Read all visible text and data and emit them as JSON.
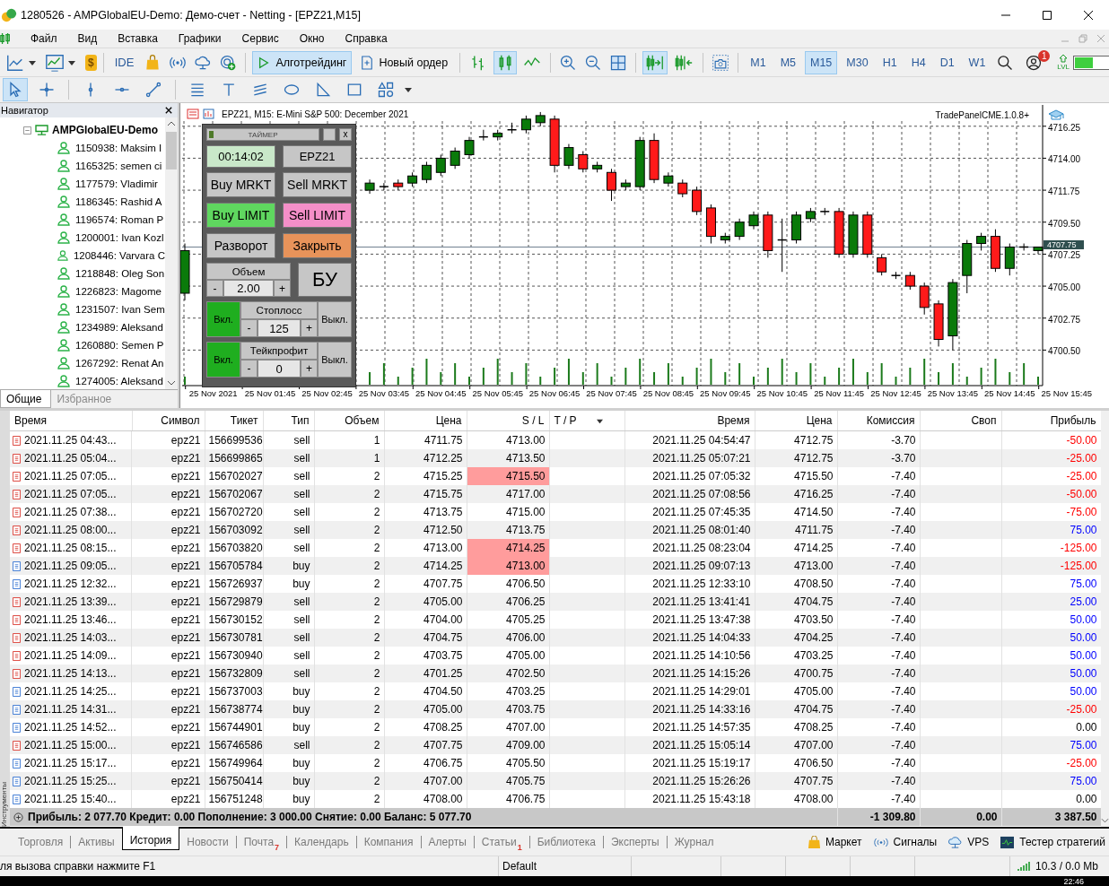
{
  "window": {
    "title": "1280526 - AMPGlobalEU-Demo: Демо-счет - Netting - [EPZ21,M15]"
  },
  "menu": [
    "Файл",
    "Вид",
    "Вставка",
    "Графики",
    "Сервис",
    "Окно",
    "Справка"
  ],
  "toolbar": {
    "wallet_symbol": "$",
    "ide": "IDE",
    "algo": {
      "label": "Алготрейдинг",
      "selected": true
    },
    "new_order": "Новый ордер",
    "chart_types": [
      {
        "kind": "bars",
        "selected": false
      },
      {
        "kind": "candles",
        "selected": true
      },
      {
        "kind": "line",
        "selected": false
      }
    ],
    "scroll_tools": [
      {
        "kind": "autoscroll",
        "selected": true
      },
      {
        "kind": "shift",
        "selected": false
      }
    ],
    "timeframes": [
      {
        "label": "M1",
        "selected": false
      },
      {
        "label": "M5",
        "selected": false
      },
      {
        "label": "M15",
        "selected": true
      },
      {
        "label": "M30",
        "selected": false
      },
      {
        "label": "H1",
        "selected": false
      },
      {
        "label": "H4",
        "selected": false
      },
      {
        "label": "D1",
        "selected": false
      },
      {
        "label": "W1",
        "selected": false
      }
    ],
    "notifications": "1",
    "level_label": "LVL"
  },
  "draw_tools": [
    {
      "kind": "cursor",
      "selected": true
    },
    {
      "kind": "crosshair",
      "selected": false
    },
    {
      "kind": "vline",
      "selected": false
    },
    {
      "kind": "hline",
      "selected": false
    },
    {
      "kind": "trend",
      "selected": false
    },
    {
      "kind": "channel",
      "selected": false
    },
    {
      "kind": "text",
      "selected": false
    },
    {
      "kind": "fibo",
      "selected": false
    },
    {
      "kind": "ellipse",
      "selected": false
    },
    {
      "kind": "triangle",
      "selected": false
    },
    {
      "kind": "rect",
      "selected": false
    },
    {
      "kind": "shapes",
      "selected": false
    }
  ],
  "navigator": {
    "title": "Навигатор",
    "server": "AMPGlobalEU-Demo",
    "accounts": [
      "1150938: Maksim I",
      "1165325: semen ci",
      "1177579: Vladimir",
      "1186345: Rashid A",
      "1196574: Roman P",
      "1200001: Ivan Kozl",
      "1208446: Varvara C",
      "1218848: Oleg Son",
      "1226823: Magome",
      "1231507: Ivan Sem",
      "1234989: Aleksand",
      "1260880: Semen P",
      "1267292: Renat An",
      "1274005: Aleksand"
    ],
    "tabs": [
      {
        "label": "Общие",
        "selected": true
      },
      {
        "label": "Избранное",
        "selected": false
      }
    ]
  },
  "chart": {
    "title": "EPZ21, M15:  E-Mini S&P 500: December 2021",
    "expert": "TradePanelCME.1.0.8+",
    "chart_data": {
      "type": "candlestick",
      "ylim": [
        4698.0,
        4717.75
      ],
      "grid": true,
      "ref_lines": [
        {
          "axis": "y",
          "value": 4707.75,
          "label": "4707.75",
          "color": "#708090"
        }
      ],
      "categories": [
        null,
        null,
        "25 Nov 2021",
        null,
        null,
        null,
        "25 Nov 01:45",
        null,
        null,
        null,
        "25 Nov 02:45",
        null,
        null,
        null,
        "25 Nov 03:45",
        null,
        null,
        null,
        "25 Nov 04:45",
        null,
        null,
        null,
        "25 Nov 05:45",
        null,
        null,
        null,
        "25 Nov 06:45",
        null,
        null,
        null,
        "25 Nov 07:45",
        null,
        null,
        null,
        "25 Nov 08:45",
        null,
        null,
        null,
        "25 Nov 09:45",
        null,
        null,
        null,
        "25 Nov 10:45",
        null,
        null,
        null,
        "25 Nov 11:45",
        null,
        null,
        null,
        "25 Nov 12:45",
        null,
        null,
        null,
        "25 Nov 13:45",
        null,
        null,
        null,
        "25 Nov 14:45",
        null,
        null,
        null,
        "25 Nov 15:45"
      ],
      "ohlc": [
        [
          4704.5,
          4708.0,
          4704.0,
          4707.5
        ],
        null,
        null,
        null,
        null,
        null,
        null,
        null,
        null,
        null,
        null,
        null,
        null,
        [
          4711.75,
          4712.5,
          4711.5,
          4712.25
        ],
        [
          4712.0,
          4712.25,
          4711.75,
          4712.0
        ],
        [
          4712.25,
          4712.5,
          4711.75,
          4712.0
        ],
        [
          4712.25,
          4713.0,
          4712.0,
          4712.75
        ],
        [
          4712.5,
          4713.75,
          4712.25,
          4713.5
        ],
        [
          4713.0,
          4714.25,
          4712.75,
          4714.0
        ],
        [
          4713.5,
          4714.75,
          4713.25,
          4714.5
        ],
        [
          4714.25,
          4715.5,
          4714.0,
          4715.25
        ],
        [
          4715.5,
          4716.0,
          4715.25,
          4715.5
        ],
        [
          4715.5,
          4716.0,
          4715.25,
          4715.75
        ],
        [
          4716.0,
          4716.5,
          4715.75,
          4716.0
        ],
        [
          4716.0,
          4717.0,
          4715.75,
          4716.75
        ],
        [
          4716.5,
          4717.25,
          4716.25,
          4717.0
        ],
        [
          4716.75,
          4717.0,
          4713.0,
          4713.5
        ],
        [
          4713.5,
          4715.0,
          4713.25,
          4714.75
        ],
        [
          4714.25,
          4714.5,
          4713.0,
          4713.25
        ],
        [
          4713.25,
          4713.75,
          4713.0,
          4713.5
        ],
        [
          4713.0,
          4713.25,
          4711.0,
          4711.75
        ],
        [
          4712.0,
          4712.5,
          4711.75,
          4712.25
        ],
        [
          4712.0,
          4715.5,
          4711.75,
          4715.25
        ],
        [
          4715.25,
          4715.75,
          4712.25,
          4712.5
        ],
        [
          4712.25,
          4713.0,
          4712.0,
          4712.75
        ],
        [
          4712.25,
          4712.5,
          4711.25,
          4711.5
        ],
        [
          4711.75,
          4712.0,
          4710.0,
          4710.25
        ],
        [
          4710.5,
          4710.75,
          4708.0,
          4708.5
        ],
        [
          4708.25,
          4708.75,
          4708.0,
          4708.5
        ],
        [
          4708.5,
          4709.75,
          4708.25,
          4709.5
        ],
        [
          4709.25,
          4710.25,
          4709.0,
          4710.0
        ],
        [
          4710.0,
          4710.25,
          4707.0,
          4707.5
        ],
        [
          4708.25,
          4709.75,
          4706.0,
          4708.25
        ],
        [
          4708.25,
          4710.25,
          4708.0,
          4710.0
        ],
        [
          4709.75,
          4710.5,
          4709.5,
          4710.25
        ],
        [
          4710.25,
          4710.5,
          4710.0,
          4710.25
        ],
        [
          4710.25,
          4710.5,
          4707.0,
          4707.25
        ],
        [
          4707.25,
          4710.25,
          4707.0,
          4710.0
        ],
        [
          4710.0,
          4710.25,
          4707.0,
          4707.25
        ],
        [
          4707.0,
          4707.25,
          4705.75,
          4706.0
        ],
        [
          4705.75,
          4706.0,
          4705.5,
          4705.75
        ],
        [
          4705.75,
          4706.0,
          4704.75,
          4705.0
        ],
        [
          4705.0,
          4705.25,
          4703.0,
          4703.5
        ],
        [
          4703.75,
          4704.0,
          4700.75,
          4701.25
        ],
        [
          4701.5,
          4705.5,
          4700.5,
          4705.25
        ],
        [
          4705.75,
          4708.25,
          4704.5,
          4708.0
        ],
        [
          4708.0,
          4708.75,
          4707.5,
          4708.5
        ],
        [
          4708.5,
          4709.0,
          4706.0,
          4706.25
        ],
        [
          4706.25,
          4708.0,
          4705.75,
          4707.75
        ],
        [
          4707.75,
          4708.0,
          4707.5,
          4707.75
        ],
        [
          4707.5,
          4707.75,
          4707.25,
          4707.75
        ],
        null,
        null
      ],
      "yticks": [
        {
          "value": 4716.25,
          "label": "4716.25"
        },
        {
          "value": 4714.0,
          "label": "4714.00"
        },
        {
          "value": 4711.75,
          "label": "4711.75"
        },
        {
          "value": 4709.5,
          "label": "4709.50"
        },
        {
          "value": 4707.25,
          "label": "4707.25"
        },
        {
          "value": 4705.0,
          "label": "4705.00"
        },
        {
          "value": 4702.75,
          "label": "4702.75"
        },
        {
          "value": 4700.5,
          "label": "4700.50"
        }
      ]
    }
  },
  "trade_panel": {
    "title": "ТАЙМЕР",
    "close": "x",
    "timer": "00:14:02",
    "symbol": "EPZ21",
    "buttons": [
      {
        "label": "Buy MRKT",
        "kind": "neutral"
      },
      {
        "label": "Sell MRKT",
        "kind": "neutral"
      },
      {
        "label": "Buy LIMIT",
        "kind": "buy"
      },
      {
        "label": "Sell LIMIT",
        "kind": "sell"
      },
      {
        "label": "Разворот",
        "kind": "neutral"
      },
      {
        "label": "Закрыть",
        "kind": "close"
      }
    ],
    "volume": {
      "label": "Объем",
      "minus": "-",
      "value": "2.00",
      "plus": "+"
    },
    "breakeven": "БУ",
    "stoploss": {
      "on": "Вкл.",
      "enabled": true,
      "label": "Стоплосс",
      "minus": "-",
      "value": "125",
      "plus": "+",
      "off": "Выкл."
    },
    "takeprofit": {
      "on": "Вкл.",
      "enabled": true,
      "label": "Тейкпрофит",
      "minus": "-",
      "value": "0",
      "plus": "+",
      "off": "Выкл."
    }
  },
  "history": {
    "columns": [
      "Время",
      "Символ",
      "Тикет",
      "Тип",
      "Объем",
      "Цена",
      "S / L",
      "T / P",
      "Время",
      "Цена",
      "Комиссия",
      "Своп",
      "Прибыль"
    ],
    "rows": [
      {
        "kind": "sell",
        "open_time": "2021.11.25 04:43...",
        "symbol": "epz21",
        "ticket": "156699536",
        "type": "sell",
        "volume": "1",
        "price": "4711.75",
        "sl": "4713.00",
        "sl_hit": false,
        "close_time": "2021.11.25 04:54:47",
        "close_price": "4712.75",
        "commission": "-3.70",
        "profit": "-50.00",
        "color": "#ff0000"
      },
      {
        "kind": "sell",
        "open_time": "2021.11.25 05:04...",
        "symbol": "epz21",
        "ticket": "156699865",
        "type": "sell",
        "volume": "1",
        "price": "4712.25",
        "sl": "4713.50",
        "sl_hit": false,
        "close_time": "2021.11.25 05:07:21",
        "close_price": "4712.75",
        "commission": "-3.70",
        "profit": "-25.00",
        "color": "#ff0000"
      },
      {
        "kind": "sell",
        "open_time": "2021.11.25 07:05...",
        "symbol": "epz21",
        "ticket": "156702027",
        "type": "sell",
        "volume": "2",
        "price": "4715.25",
        "sl": "4715.50",
        "sl_hit": true,
        "close_time": "2021.11.25 07:05:32",
        "close_price": "4715.50",
        "commission": "-7.40",
        "profit": "-25.00",
        "color": "#ff0000"
      },
      {
        "kind": "sell",
        "open_time": "2021.11.25 07:05...",
        "symbol": "epz21",
        "ticket": "156702067",
        "type": "sell",
        "volume": "2",
        "price": "4715.75",
        "sl": "4717.00",
        "sl_hit": false,
        "close_time": "2021.11.25 07:08:56",
        "close_price": "4716.25",
        "commission": "-7.40",
        "profit": "-50.00",
        "color": "#ff0000"
      },
      {
        "kind": "sell",
        "open_time": "2021.11.25 07:38...",
        "symbol": "epz21",
        "ticket": "156702720",
        "type": "sell",
        "volume": "2",
        "price": "4713.75",
        "sl": "4715.00",
        "sl_hit": false,
        "close_time": "2021.11.25 07:45:35",
        "close_price": "4714.50",
        "commission": "-7.40",
        "profit": "-75.00",
        "color": "#ff0000"
      },
      {
        "kind": "sell",
        "open_time": "2021.11.25 08:00...",
        "symbol": "epz21",
        "ticket": "156703092",
        "type": "sell",
        "volume": "2",
        "price": "4712.50",
        "sl": "4713.75",
        "sl_hit": false,
        "close_time": "2021.11.25 08:01:40",
        "close_price": "4711.75",
        "commission": "-7.40",
        "profit": "75.00",
        "color": "#0000ff"
      },
      {
        "kind": "sell",
        "open_time": "2021.11.25 08:15...",
        "symbol": "epz21",
        "ticket": "156703820",
        "type": "sell",
        "volume": "2",
        "price": "4713.00",
        "sl": "4714.25",
        "sl_hit": true,
        "close_time": "2021.11.25 08:23:04",
        "close_price": "4714.25",
        "commission": "-7.40",
        "profit": "-125.00",
        "color": "#ff0000"
      },
      {
        "kind": "buy",
        "open_time": "2021.11.25 09:05...",
        "symbol": "epz21",
        "ticket": "156705784",
        "type": "buy",
        "volume": "2",
        "price": "4714.25",
        "sl": "4713.00",
        "sl_hit": true,
        "close_time": "2021.11.25 09:07:13",
        "close_price": "4713.00",
        "commission": "-7.40",
        "profit": "-125.00",
        "color": "#ff0000"
      },
      {
        "kind": "buy",
        "open_time": "2021.11.25 12:32...",
        "symbol": "epz21",
        "ticket": "156726937",
        "type": "buy",
        "volume": "2",
        "price": "4707.75",
        "sl": "4706.50",
        "sl_hit": false,
        "close_time": "2021.11.25 12:33:10",
        "close_price": "4708.50",
        "commission": "-7.40",
        "profit": "75.00",
        "color": "#0000ff"
      },
      {
        "kind": "sell",
        "open_time": "2021.11.25 13:39...",
        "symbol": "epz21",
        "ticket": "156729879",
        "type": "sell",
        "volume": "2",
        "price": "4705.00",
        "sl": "4706.25",
        "sl_hit": false,
        "close_time": "2021.11.25 13:41:41",
        "close_price": "4704.75",
        "commission": "-7.40",
        "profit": "25.00",
        "color": "#0000ff"
      },
      {
        "kind": "sell",
        "open_time": "2021.11.25 13:46...",
        "symbol": "epz21",
        "ticket": "156730152",
        "type": "sell",
        "volume": "2",
        "price": "4704.00",
        "sl": "4705.25",
        "sl_hit": false,
        "close_time": "2021.11.25 13:47:38",
        "close_price": "4703.50",
        "commission": "-7.40",
        "profit": "50.00",
        "color": "#0000ff"
      },
      {
        "kind": "sell",
        "open_time": "2021.11.25 14:03...",
        "symbol": "epz21",
        "ticket": "156730781",
        "type": "sell",
        "volume": "2",
        "price": "4704.75",
        "sl": "4706.00",
        "sl_hit": false,
        "close_time": "2021.11.25 14:04:33",
        "close_price": "4704.25",
        "commission": "-7.40",
        "profit": "50.00",
        "color": "#0000ff"
      },
      {
        "kind": "sell",
        "open_time": "2021.11.25 14:09...",
        "symbol": "epz21",
        "ticket": "156730940",
        "type": "sell",
        "volume": "2",
        "price": "4703.75",
        "sl": "4705.00",
        "sl_hit": false,
        "close_time": "2021.11.25 14:10:56",
        "close_price": "4703.25",
        "commission": "-7.40",
        "profit": "50.00",
        "color": "#0000ff"
      },
      {
        "kind": "sell",
        "open_time": "2021.11.25 14:13...",
        "symbol": "epz21",
        "ticket": "156732809",
        "type": "sell",
        "volume": "2",
        "price": "4701.25",
        "sl": "4702.50",
        "sl_hit": false,
        "close_time": "2021.11.25 14:15:26",
        "close_price": "4700.75",
        "commission": "-7.40",
        "profit": "50.00",
        "color": "#0000ff"
      },
      {
        "kind": "buy",
        "open_time": "2021.11.25 14:25...",
        "symbol": "epz21",
        "ticket": "156737003",
        "type": "buy",
        "volume": "2",
        "price": "4704.50",
        "sl": "4703.25",
        "sl_hit": false,
        "close_time": "2021.11.25 14:29:01",
        "close_price": "4705.00",
        "commission": "-7.40",
        "profit": "50.00",
        "color": "#0000ff"
      },
      {
        "kind": "buy",
        "open_time": "2021.11.25 14:31...",
        "symbol": "epz21",
        "ticket": "156738774",
        "type": "buy",
        "volume": "2",
        "price": "4705.00",
        "sl": "4703.75",
        "sl_hit": false,
        "close_time": "2021.11.25 14:33:16",
        "close_price": "4704.75",
        "commission": "-7.40",
        "profit": "-25.00",
        "color": "#ff0000"
      },
      {
        "kind": "buy",
        "open_time": "2021.11.25 14:52...",
        "symbol": "epz21",
        "ticket": "156744901",
        "type": "buy",
        "volume": "2",
        "price": "4708.25",
        "sl": "4707.00",
        "sl_hit": false,
        "close_time": "2021.11.25 14:57:35",
        "close_price": "4708.25",
        "commission": "-7.40",
        "profit": "0.00",
        "color": "#000000"
      },
      {
        "kind": "sell",
        "open_time": "2021.11.25 15:00...",
        "symbol": "epz21",
        "ticket": "156746586",
        "type": "sell",
        "volume": "2",
        "price": "4707.75",
        "sl": "4709.00",
        "sl_hit": false,
        "close_time": "2021.11.25 15:05:14",
        "close_price": "4707.00",
        "commission": "-7.40",
        "profit": "75.00",
        "color": "#0000ff"
      },
      {
        "kind": "buy",
        "open_time": "2021.11.25 15:17...",
        "symbol": "epz21",
        "ticket": "156749964",
        "type": "buy",
        "volume": "2",
        "price": "4706.75",
        "sl": "4705.50",
        "sl_hit": false,
        "close_time": "2021.11.25 15:19:17",
        "close_price": "4706.50",
        "commission": "-7.40",
        "profit": "-25.00",
        "color": "#ff0000"
      },
      {
        "kind": "buy",
        "open_time": "2021.11.25 15:25...",
        "symbol": "epz21",
        "ticket": "156750414",
        "type": "buy",
        "volume": "2",
        "price": "4707.00",
        "sl": "4705.75",
        "sl_hit": false,
        "close_time": "2021.11.25 15:26:26",
        "close_price": "4707.75",
        "commission": "-7.40",
        "profit": "75.00",
        "color": "#0000ff"
      },
      {
        "kind": "buy",
        "open_time": "2021.11.25 15:40...",
        "symbol": "epz21",
        "ticket": "156751248",
        "type": "buy",
        "volume": "2",
        "price": "4708.00",
        "sl": "4706.75",
        "sl_hit": false,
        "close_time": "2021.11.25 15:43:18",
        "close_price": "4708.00",
        "commission": "-7.40",
        "profit": "0.00",
        "color": "#000000"
      }
    ],
    "summary": "Прибыль: 2 077.70  Кредит: 0.00  Пополнение: 3 000.00  Снятие: 0.00  Баланс: 5 077.70",
    "totals": {
      "commission": "-1 309.80",
      "swap": "0.00",
      "profit": "3 387.50"
    }
  },
  "side_label": "Инструменты",
  "bottom_tabs": [
    {
      "label": "Торговля",
      "selected": false
    },
    {
      "label": "Активы",
      "selected": false
    },
    {
      "label": "История",
      "selected": true
    },
    {
      "label": "Новости",
      "selected": false
    },
    {
      "label": "Почта",
      "selected": false,
      "badge": "7"
    },
    {
      "label": "Календарь",
      "selected": false
    },
    {
      "label": "Компания",
      "selected": false
    },
    {
      "label": "Алерты",
      "selected": false
    },
    {
      "label": "Статьи",
      "selected": false,
      "badge": "1"
    },
    {
      "label": "Библиотека",
      "selected": false
    },
    {
      "label": "Эксперты",
      "selected": false
    },
    {
      "label": "Журнал",
      "selected": false
    }
  ],
  "services": [
    {
      "kind": "market",
      "label": "Маркет"
    },
    {
      "kind": "signals",
      "label": "Сигналы"
    },
    {
      "kind": "vps",
      "label": "VPS"
    },
    {
      "kind": "tester",
      "label": "Тестер стратегий"
    }
  ],
  "status_bar": {
    "help": "ля вызова справки нажмите F1",
    "profile": "Default",
    "traffic": "10.3 / 0.0 Mb"
  },
  "taskbar": {
    "clock": "22:46"
  }
}
